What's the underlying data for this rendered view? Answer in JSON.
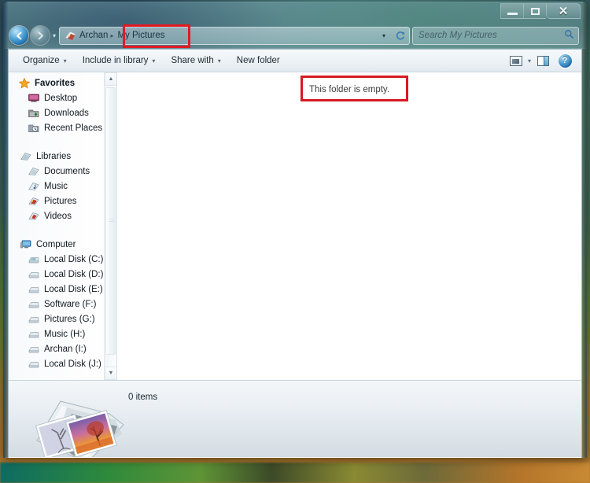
{
  "window": {
    "caption_buttons": [
      {
        "name": "minimize",
        "label": "–"
      },
      {
        "name": "maximize",
        "label": "□"
      },
      {
        "name": "close",
        "label": "✕"
      }
    ]
  },
  "address_bar": {
    "back_label": "←",
    "forward_label": "→",
    "nav_history_caret": "▾",
    "breadcrumb": {
      "separator": "▸",
      "items": [
        {
          "label": "Archan",
          "icon": "pictures-library-icon"
        },
        {
          "label": "My Pictures",
          "icon": ""
        }
      ],
      "highlighted_item": "My Pictures"
    },
    "dropdown_caret": "▾",
    "refresh_label": "↻",
    "search": {
      "placeholder": "Search My Pictures",
      "value": "",
      "icon": "search-icon"
    }
  },
  "toolbar": {
    "items": [
      {
        "label": "Organize",
        "has_caret": true
      },
      {
        "label": "Include in library",
        "has_caret": true
      },
      {
        "label": "Share with",
        "has_caret": true
      },
      {
        "label": "New folder",
        "has_caret": false
      }
    ],
    "caret": "▾",
    "right_icons": [
      {
        "name": "change-view-icon",
        "label": ""
      },
      {
        "name": "view-dropdown-caret",
        "label": "▾"
      },
      {
        "name": "preview-pane-icon",
        "label": ""
      },
      {
        "name": "help-icon",
        "label": "?"
      }
    ]
  },
  "sidebar": {
    "groups": [
      {
        "header": {
          "label": "Favorites",
          "icon": "star-icon"
        },
        "items": [
          {
            "label": "Desktop",
            "icon": "desktop-icon"
          },
          {
            "label": "Downloads",
            "icon": "downloads-icon"
          },
          {
            "label": "Recent Places",
            "icon": "recent-places-icon"
          }
        ]
      },
      {
        "header": {
          "label": "Libraries",
          "icon": "libraries-icon"
        },
        "items": [
          {
            "label": "Documents",
            "icon": "documents-icon"
          },
          {
            "label": "Music",
            "icon": "music-icon"
          },
          {
            "label": "Pictures",
            "icon": "pictures-icon"
          },
          {
            "label": "Videos",
            "icon": "videos-icon"
          }
        ]
      },
      {
        "header": {
          "label": "Computer",
          "icon": "computer-icon"
        },
        "items": [
          {
            "label": "Local Disk (C:)",
            "icon": "system-drive-icon"
          },
          {
            "label": "Local Disk (D:)",
            "icon": "drive-icon"
          },
          {
            "label": "Local Disk (E:)",
            "icon": "drive-icon"
          },
          {
            "label": "Software (F:)",
            "icon": "drive-icon"
          },
          {
            "label": "Pictures (G:)",
            "icon": "drive-icon"
          },
          {
            "label": "Music (H:)",
            "icon": "drive-icon"
          },
          {
            "label": "Archan (I:)",
            "icon": "drive-icon"
          },
          {
            "label": "Local Disk (J:)",
            "icon": "drive-icon"
          }
        ]
      }
    ],
    "scrollbar": {
      "up_arrow": "▲",
      "down_arrow": "▼"
    }
  },
  "file_pane": {
    "empty_message": "This folder is empty.",
    "highlighted": true
  },
  "status_bar": {
    "item_count_text": "0 items",
    "library_icon": "pictures-library-icon"
  },
  "annotations": {
    "color": "#d61a21",
    "boxes": [
      "breadcrumb-my-pictures",
      "empty-folder-message"
    ]
  }
}
